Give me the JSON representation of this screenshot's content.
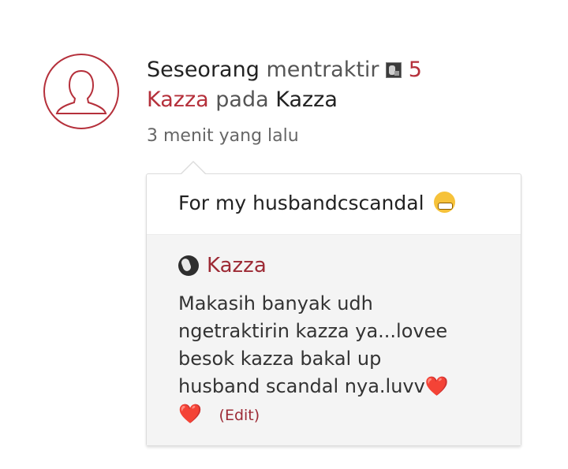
{
  "notification": {
    "actor": "Seseorang",
    "verb": "mentraktir",
    "quantity": "5",
    "item_label": "Kazza",
    "preposition": "pada",
    "target": "Kazza",
    "timestamp": "3 menit yang lalu",
    "message": "For my husbandcscandal",
    "message_emoji": "grinning-face-emoji"
  },
  "reply": {
    "author": "Kazza",
    "line1": "Makasih banyak udh",
    "line2": "ngetraktirin kazza ya...lovee",
    "line3": "besok kazza bakal up",
    "line4": "husband scandal nya.luvv",
    "heart": "❤️",
    "heart2": "❤️",
    "edit_label": "(Edit)"
  },
  "colors": {
    "accent": "#b5303b",
    "reply_author": "#9d2a35",
    "muted_text": "#666666",
    "reply_background": "#f4f4f4"
  }
}
